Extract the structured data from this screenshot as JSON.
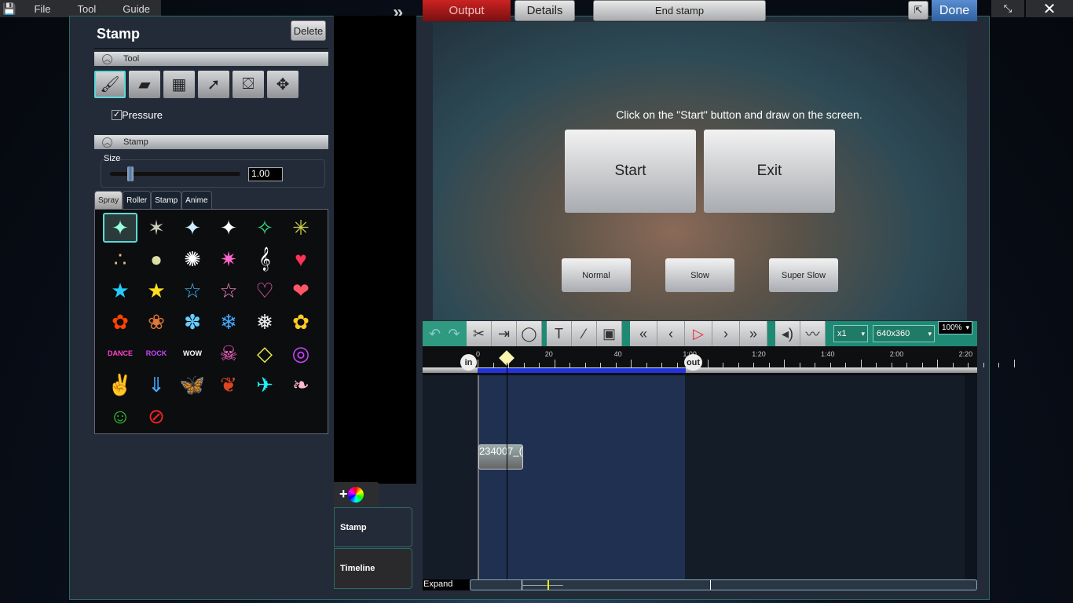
{
  "menu": {
    "items": [
      "File",
      "Tool",
      "Guide"
    ]
  },
  "left": {
    "title": "Stamp",
    "delete": "Delete",
    "tool_section": "Tool",
    "pressure": "Pressure",
    "pressure_checked": true,
    "stamp_section": "Stamp",
    "size_label": "Size",
    "size_value": "1.00",
    "size_fraction": 0.05,
    "tabs": [
      "Spray",
      "Roller",
      "Stamp",
      "Anime"
    ],
    "stamps": [
      {
        "g": "✦",
        "c": "#9fd"
      },
      {
        "g": "✶",
        "c": "#ccb"
      },
      {
        "g": "✦",
        "c": "#cef"
      },
      {
        "g": "✦",
        "c": "#fff"
      },
      {
        "g": "✧",
        "c": "#3d8"
      },
      {
        "g": "✳",
        "c": "#cc4"
      },
      {
        "g": "∴",
        "c": "#eb8"
      },
      {
        "g": "●",
        "c": "#dda"
      },
      {
        "g": "✺",
        "c": "#fff"
      },
      {
        "g": "✷",
        "c": "#f6c"
      },
      {
        "g": "𝄞",
        "c": "#fff"
      },
      {
        "g": "♥",
        "c": "#f35"
      },
      {
        "g": "★",
        "c": "#2cf"
      },
      {
        "g": "★",
        "c": "#fd2"
      },
      {
        "g": "☆",
        "c": "#4bf"
      },
      {
        "g": "☆",
        "c": "#f8c"
      },
      {
        "g": "♡",
        "c": "#f6c"
      },
      {
        "g": "❤",
        "c": "#f56"
      },
      {
        "g": "✿",
        "c": "#f40"
      },
      {
        "g": "❀",
        "c": "#d73"
      },
      {
        "g": "✽",
        "c": "#6cf"
      },
      {
        "g": "❄",
        "c": "#4af"
      },
      {
        "g": "❅",
        "c": "#eee"
      },
      {
        "g": "✿",
        "c": "#fc2"
      },
      {
        "g": "DANCE",
        "c": "#f4c"
      },
      {
        "g": "ROCK",
        "c": "#c4f"
      },
      {
        "g": "WOW",
        "c": "#fff"
      },
      {
        "g": "☠",
        "c": "#f6c"
      },
      {
        "g": "◇",
        "c": "#ee4"
      },
      {
        "g": "◎",
        "c": "#c4f"
      },
      {
        "g": "✌",
        "c": "#fff"
      },
      {
        "g": "⇓",
        "c": "#4af"
      },
      {
        "g": "🦋",
        "c": "#c9e"
      },
      {
        "g": "❦",
        "c": "#d42"
      },
      {
        "g": "✈",
        "c": "#2ef"
      },
      {
        "g": "❧",
        "c": "#fbc"
      },
      {
        "g": "☺",
        "c": "#3c3"
      },
      {
        "g": "⊘",
        "c": "#e22"
      }
    ]
  },
  "side": {
    "add": "+",
    "stamp_tab": "Stamp",
    "timeline_tab": "Timeline"
  },
  "top": {
    "output": "Output",
    "details": "Details",
    "end_stamp": "End stamp",
    "done": "Done"
  },
  "preview": {
    "instruction": "Click on the \"Start\" button and draw on the screen.",
    "start": "Start",
    "exit": "Exit",
    "normal": "Normal",
    "slow": "Slow",
    "super_slow": "Super Slow"
  },
  "toolbar": {
    "speed": "x1",
    "resolution": "640x360",
    "zoom": "100%"
  },
  "ruler": {
    "ticks": [
      "0",
      "20",
      "40",
      "1:00",
      "1:20",
      "1:40",
      "2:00",
      "2:20"
    ],
    "in": "in",
    "out": "out"
  },
  "timeline": {
    "clip": "234007_(",
    "expand": "Expand"
  }
}
